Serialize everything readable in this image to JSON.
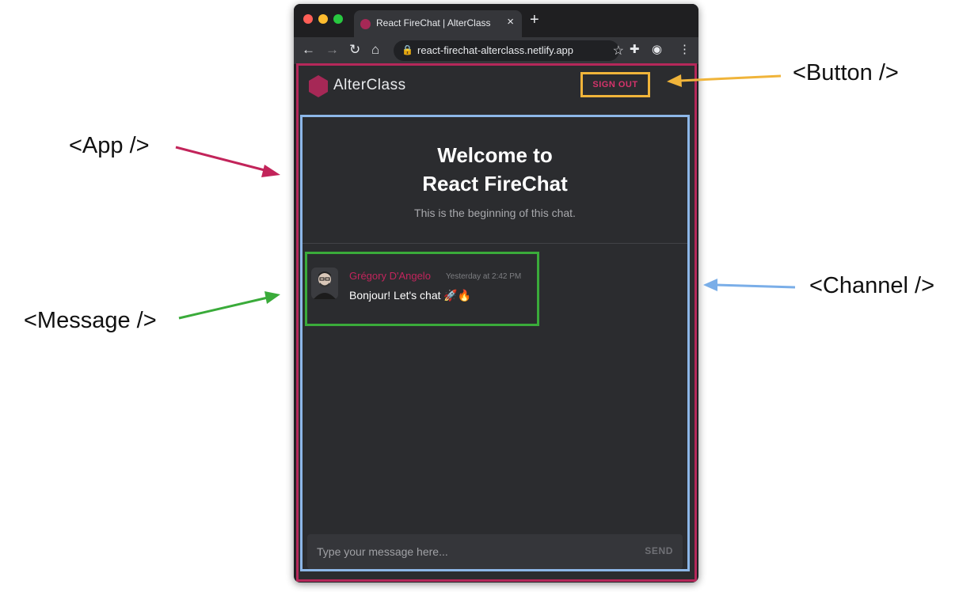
{
  "annotations": {
    "app": "<App />",
    "message": "<Message />",
    "button": "<Button />",
    "channel": "<Channel />"
  },
  "browser": {
    "tab_title": "React FireChat | AlterClass",
    "url": "react-firechat-alterclass.netlify.app",
    "icons": [
      "back-icon",
      "forward-icon",
      "reload-icon",
      "home-icon",
      "lock-icon",
      "star-icon",
      "extensions-icon",
      "incognito-icon",
      "menu-icon"
    ]
  },
  "app": {
    "brand": "AlterClass",
    "sign_out": "SIGN OUT",
    "accent": "#b5285a"
  },
  "channel": {
    "welcome_line1": "Welcome to",
    "welcome_line2": "React FireChat",
    "subtitle": "This is the beginning of this chat.",
    "messages": [
      {
        "author": "Grégory D'Angelo",
        "time": "Yesterday at 2:42 PM",
        "text": "Bonjour! Let's chat 🚀🔥"
      }
    ],
    "input_placeholder": "Type your message here...",
    "send_label": "SEND"
  },
  "colors": {
    "app_outline": "#b5285a",
    "channel_outline": "#8db7e8",
    "message_outline": "#3aab3a",
    "button_outline": "#f0b43a"
  }
}
